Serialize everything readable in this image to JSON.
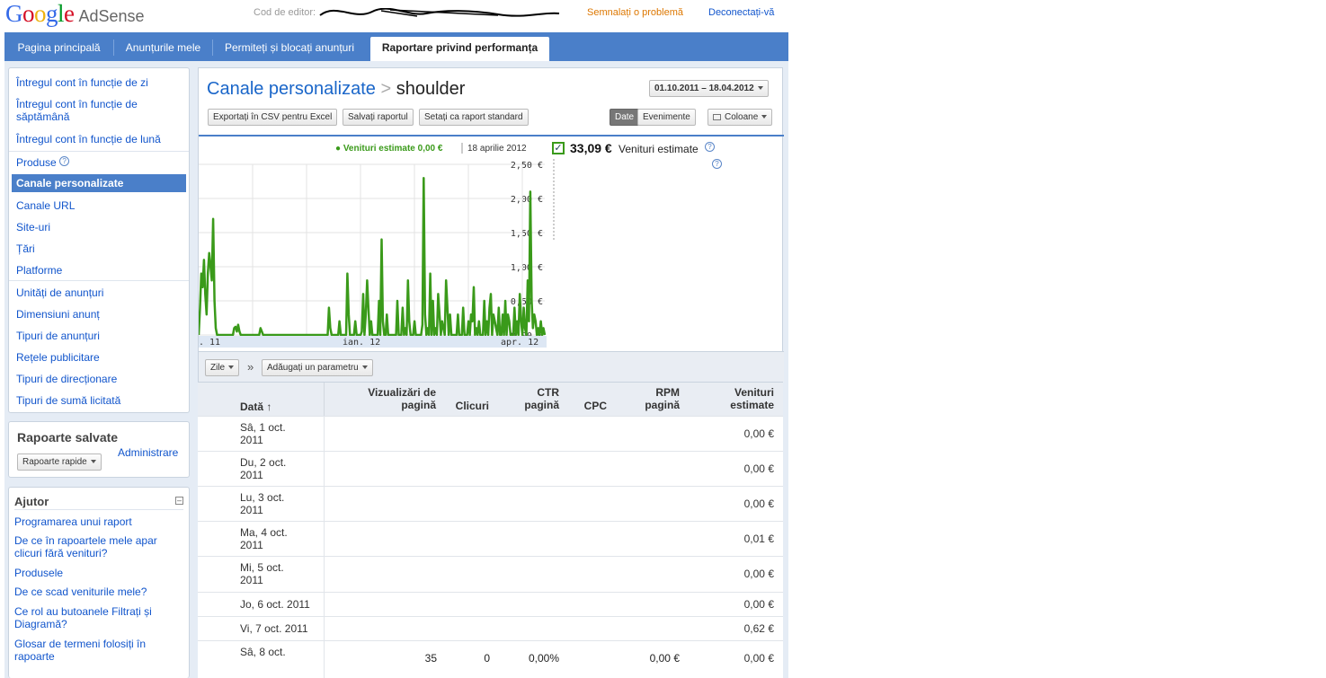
{
  "brand": {
    "google": "Google",
    "product": "AdSense"
  },
  "header": {
    "editor_label": "Cod de editor:",
    "report_problem": "Semnalați o problemă",
    "logout": "Deconectați-vă"
  },
  "nav": {
    "tabs": [
      {
        "label": "Pagina principală"
      },
      {
        "label": "Anunțurile mele"
      },
      {
        "label": "Permiteți și blocați anunțuri"
      },
      {
        "label": "Raportare privind performanța"
      }
    ]
  },
  "sidebar": {
    "items": [
      {
        "label": "Întregul cont în funcție de zi"
      },
      {
        "label": "Întregul cont în funcție de săptămână"
      },
      {
        "label": "Întregul cont în funcție de lună"
      },
      {
        "label": "Produse"
      },
      {
        "label": "Canale personalizate"
      },
      {
        "label": "Canale URL"
      },
      {
        "label": "Site-uri"
      },
      {
        "label": "Țări"
      },
      {
        "label": "Platforme"
      },
      {
        "label": "Unități de anunțuri"
      },
      {
        "label": "Dimensiuni anunț"
      },
      {
        "label": "Tipuri de anunțuri"
      },
      {
        "label": "Rețele publicitare"
      },
      {
        "label": "Tipuri de direcționare"
      },
      {
        "label": "Tipuri de sumă licitată"
      }
    ],
    "saved_reports": {
      "title": "Rapoarte salvate",
      "admin_link": "Administrare",
      "dropdown": "Rapoarte rapide"
    },
    "help": {
      "title": "Ajutor",
      "links": [
        {
          "label": "Programarea unui raport"
        },
        {
          "label": "De ce în rapoartele mele apar clicuri fără venituri?"
        },
        {
          "label": "Produsele"
        },
        {
          "label": "De ce scad veniturile mele?"
        },
        {
          "label": "Ce rol au butoanele Filtrați și Diagramă?"
        },
        {
          "label": "Glosar de termeni folosiți în rapoarte"
        }
      ]
    }
  },
  "report": {
    "breadcrumb_parent": "Canale personalizate",
    "breadcrumb_sep": ">",
    "breadcrumb_current": "shoulder",
    "date_range": "01.10.2011 – 18.04.2012",
    "buttons": {
      "export": "Exportați în CSV pentru Excel",
      "save": "Salvați raportul",
      "set_default": "Setați ca raport standard"
    },
    "toggle": {
      "date": "Date",
      "events": "Evenimente"
    },
    "columns_button": "Coloane",
    "chart_legend": "Venituri estimate 0,00 €",
    "chart_legend_date": "18 aprilie 2012",
    "total_value": "33,09 €",
    "total_label": "Venituri estimate",
    "checkmark": "✓",
    "help_glyph": "?",
    "dim_dropdown": "Zile",
    "add_param": "Adăugați un parametru",
    "chevrons": "»"
  },
  "chart_data": {
    "type": "line",
    "ylim": [
      0,
      2.5
    ],
    "y_ticks": [
      "2,50 €",
      "2,00 €",
      "1,50 €",
      "1,00 €",
      "0,50 €",
      "0,00 €"
    ],
    "x_ticks": [
      ". 11",
      "ian. 12",
      "apr. 12"
    ],
    "series": [
      {
        "name": "Venituri estimate",
        "color": "#3a9a1a",
        "values": [
          0,
          0.4,
          0.9,
          0.7,
          1.1,
          0.6,
          0.3,
          0.9,
          1.2,
          1.0,
          0.8,
          1.7,
          0.5,
          0.1,
          0,
          0,
          0,
          0,
          0,
          0,
          0,
          0,
          0,
          0,
          0,
          0,
          0,
          0.1,
          0.12,
          0.05,
          0.15,
          0.05,
          0,
          0,
          0,
          0,
          0,
          0,
          0,
          0,
          0,
          0,
          0,
          0,
          0,
          0,
          0,
          0.1,
          0.05,
          0,
          0,
          0,
          0,
          0,
          0,
          0,
          0,
          0,
          0,
          0,
          0,
          0,
          0,
          0,
          0,
          0,
          0,
          0,
          0,
          0,
          0,
          0,
          0,
          0,
          0,
          0,
          0,
          0,
          0,
          0,
          0,
          0,
          0,
          0,
          0,
          0,
          0,
          0,
          0,
          0,
          0,
          0,
          0,
          0,
          0,
          0,
          0,
          0,
          0,
          0.4,
          0.1,
          0,
          0,
          0,
          0,
          0,
          0,
          0.2,
          0,
          0,
          0,
          0,
          0,
          0.9,
          0.3,
          0,
          0,
          0,
          0,
          0.2,
          0,
          0,
          0,
          0,
          0.05,
          0.6,
          0,
          0.3,
          0.8,
          0.4,
          0,
          0.2,
          0,
          0,
          0,
          0,
          0,
          0.5,
          0,
          1.4,
          0.2,
          0,
          0,
          0.3,
          0,
          0,
          0,
          0,
          0,
          0,
          0,
          0.5,
          0,
          0,
          0,
          0.4,
          0,
          0.1,
          0,
          0.8,
          0.2,
          0,
          0,
          0,
          0.2,
          0,
          0,
          0,
          0,
          0,
          0.15,
          2.3,
          0.3,
          0,
          0.1,
          0,
          0.9,
          0,
          0.5,
          0,
          0.1,
          0,
          0.6,
          0.3,
          0,
          0.2,
          0.1,
          0,
          0.8,
          0.4,
          0,
          0.3,
          0,
          0,
          0,
          0,
          0,
          0.3,
          0,
          0,
          0,
          0.4,
          0,
          0,
          0,
          0.2,
          0,
          0.3,
          0.2,
          0.7,
          0,
          0.1,
          0,
          0.2,
          0,
          0,
          0,
          0.5,
          0,
          0.2,
          0,
          0.4,
          0.6,
          0,
          0.3,
          0.2,
          0.1,
          0,
          0.4,
          0,
          0,
          0.3,
          0,
          0.5,
          0,
          0.3,
          0.2,
          0,
          0,
          0,
          0.4,
          0,
          0.2,
          0,
          0.6,
          0.2,
          0,
          0.4,
          0.1,
          0,
          0.8,
          0.2,
          2.1,
          0.5,
          0.1,
          0.3,
          0.2,
          0,
          0.1,
          0,
          0.2,
          0,
          0.1,
          0
        ]
      }
    ]
  },
  "table": {
    "headers": {
      "date": "Dată",
      "pageviews": "Vizualizări de pagină",
      "clicks": "Clicuri",
      "ctr": "CTR pagină",
      "cpc": "CPC",
      "rpm": "RPM pagină",
      "revenue": "Venituri estimate"
    },
    "sort_glyph": "↑",
    "rows": [
      {
        "date": "Sâ, 1 oct. 2011",
        "revenue": "0,00 €"
      },
      {
        "date": "Du, 2 oct. 2011",
        "revenue": "0,00 €"
      },
      {
        "date": "Lu, 3 oct. 2011",
        "revenue": "0,00 €"
      },
      {
        "date": "Ma, 4 oct. 2011",
        "revenue": "0,01 €"
      },
      {
        "date": "Mi, 5 oct. 2011",
        "revenue": "0,00 €"
      },
      {
        "date": "Jo, 6 oct. 2011",
        "revenue": "0,00 €"
      },
      {
        "date": "Vi, 7 oct. 2011",
        "revenue": "0,62 €"
      },
      {
        "date": "Sâ, 8 oct.",
        "pageviews": "35",
        "clicks": "0",
        "ctr": "0,00%",
        "rpm": "0,00 €",
        "revenue": "0,00 €"
      }
    ]
  }
}
